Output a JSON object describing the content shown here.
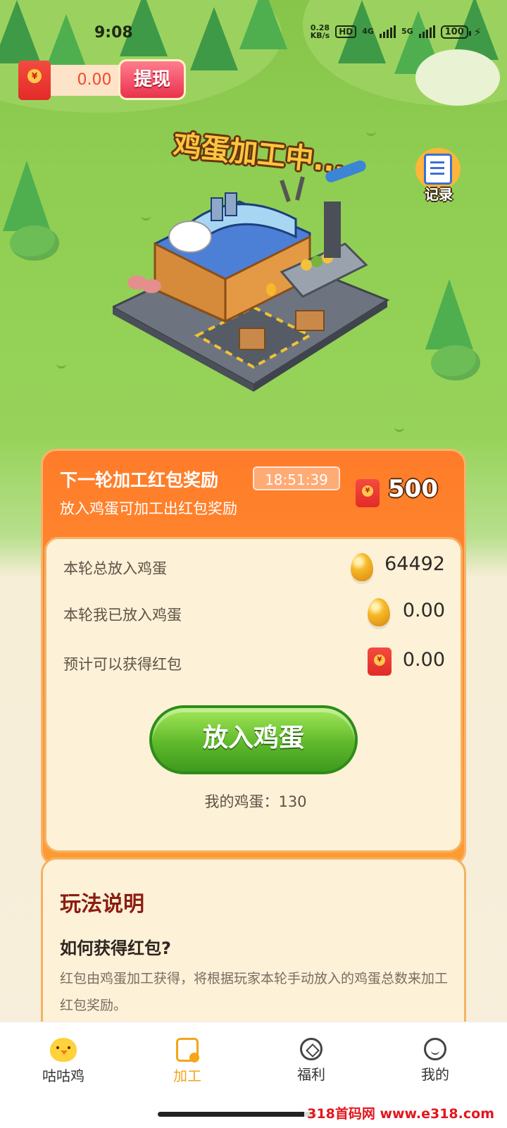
{
  "status_bar": {
    "time": "9:08",
    "speed_value": "0.28",
    "speed_unit": "KB/s",
    "hd_badge": "HD",
    "net1": "4G",
    "net2": "5G",
    "battery": "100"
  },
  "balance": {
    "currency_symbol": "¥",
    "amount": "0.00",
    "withdraw_label": "提现"
  },
  "scene": {
    "processing_title": "鸡蛋加工中...",
    "record_label": "记录"
  },
  "reward": {
    "title": "下一轮加工红包奖励",
    "timer": "18:51:39",
    "subtitle": "放入鸡蛋可加工出红包奖励",
    "value": "500",
    "stats": [
      {
        "label": "本轮总放入鸡蛋",
        "icon": "egg-icon",
        "value": "64492"
      },
      {
        "label": "本轮我已放入鸡蛋",
        "icon": "egg-icon",
        "value": "0.00"
      },
      {
        "label": "预计可以获得红包",
        "icon": "red-packet-icon",
        "value": "0.00"
      }
    ],
    "put_button": "放入鸡蛋",
    "my_eggs": "我的鸡蛋：130"
  },
  "rules": {
    "title": "玩法说明",
    "subtitle": "如何获得红包?",
    "text": "红包由鸡蛋加工获得，将根据玩家本轮手动放入的鸡蛋总数来加工红包奖励。"
  },
  "nav": {
    "items": [
      {
        "label": "咕咕鸡",
        "icon": "chick-icon",
        "active": false
      },
      {
        "label": "加工",
        "icon": "process-icon",
        "active": true
      },
      {
        "label": "福利",
        "icon": "welfare-icon",
        "active": false
      },
      {
        "label": "我的",
        "icon": "profile-icon",
        "active": false
      }
    ]
  },
  "watermark": "318首码网 www.e318.com",
  "colors": {
    "accent_orange": "#ff8a2b",
    "button_green": "#5fb92b",
    "nav_active": "#f4a51a",
    "red_packet": "#e22b27"
  }
}
